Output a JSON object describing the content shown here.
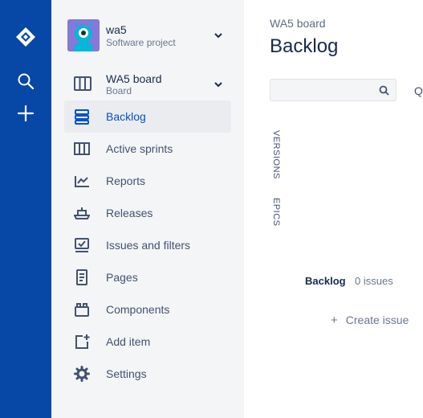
{
  "global_nav": {
    "icons": [
      "jira-logo-icon",
      "search-icon",
      "create-plus-icon"
    ]
  },
  "project": {
    "name": "wa5",
    "type": "Software project"
  },
  "board": {
    "name": "WA5 board",
    "subtitle": "Board"
  },
  "sidebar": {
    "items": [
      {
        "label": "Backlog",
        "icon": "backlog-icon",
        "active": true
      },
      {
        "label": "Active sprints",
        "icon": "active-sprints-icon"
      },
      {
        "label": "Reports",
        "icon": "reports-icon"
      },
      {
        "label": "Releases",
        "icon": "releases-icon"
      },
      {
        "label": "Issues and filters",
        "icon": "issues-filters-icon"
      },
      {
        "label": "Pages",
        "icon": "pages-icon"
      },
      {
        "label": "Components",
        "icon": "components-icon"
      },
      {
        "label": "Add item",
        "icon": "add-item-icon"
      },
      {
        "label": "Settings",
        "icon": "settings-gear-icon"
      }
    ]
  },
  "main": {
    "breadcrumb": "WA5 board",
    "title": "Backlog",
    "search": {
      "value": "",
      "placeholder": ""
    },
    "quick_filter_label": "Q",
    "side_tabs": [
      "VERSIONS",
      "EPICS"
    ],
    "backlog": {
      "label": "Backlog",
      "count": "0 issues"
    },
    "create_issue": "Create issue"
  },
  "colors": {
    "global_nav": "#0747A6",
    "sidebar_bg": "#F4F5F7",
    "active_text": "#0052CC",
    "avatar": "#8777D9"
  }
}
